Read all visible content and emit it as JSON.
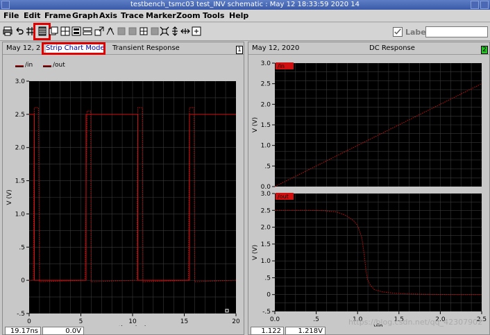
{
  "window": {
    "title": "testbench_tsmc03 test_INV schematic : May 12 18:33:59 2020 14"
  },
  "menu": [
    "File",
    "Edit",
    "Frame",
    "Graph",
    "Axis",
    "Trace",
    "Marker",
    "Zoom",
    "Tools",
    "Help"
  ],
  "toolbar": {
    "label_text": "Label",
    "label_value": ""
  },
  "left_panel": {
    "date": "May 12, 2",
    "mode": "Strip Chart Mode",
    "title": "Transient Response",
    "number": "1",
    "legend": [
      "/in",
      "/out"
    ],
    "status": [
      "19.17ns",
      "0.0V"
    ]
  },
  "right_panel": {
    "date": "May 12, 2020",
    "title": "DC Response",
    "number": "2",
    "status": [
      "1.122",
      "1.218V"
    ],
    "watermark": "https://blog.csdn.net/qq_42307902"
  },
  "colors": {
    "trace": "#d01010",
    "plot_bg": "#000000",
    "grid": "#3a3a3a",
    "num_box_right": "#22c322"
  },
  "chart_data": [
    {
      "type": "line",
      "name": "transient",
      "xlabel": "time (ns)",
      "ylabel": "V (V)",
      "xlim": [
        0,
        20
      ],
      "ylim": [
        -0.5,
        3.0
      ],
      "xticks": [
        "0",
        "5",
        "10",
        "15",
        "20"
      ],
      "yticks": [
        "-.5",
        "0",
        ".5",
        "1.0",
        "1.5",
        "2.0",
        "2.5",
        "3.0"
      ],
      "series": [
        {
          "name": "/in",
          "style": "solid",
          "x": [
            0,
            0.5,
            0.5,
            5.5,
            5.5,
            10.5,
            10.5,
            15.5,
            15.5,
            20
          ],
          "y": [
            2.5,
            2.5,
            0,
            0,
            2.5,
            2.5,
            0,
            0,
            2.5,
            2.5
          ]
        },
        {
          "name": "/out",
          "style": "dotted",
          "x": [
            0,
            0.4,
            0.5,
            0.9,
            1.0,
            5.4,
            5.6,
            5.95,
            6.0,
            10.4,
            10.5,
            10.95,
            11.0,
            15.4,
            15.5,
            15.95,
            16.0,
            20
          ],
          "y": [
            0,
            0,
            2.6,
            2.6,
            -0.02,
            0,
            2.55,
            2.55,
            -0.02,
            0,
            2.6,
            2.6,
            -0.02,
            0,
            2.6,
            2.6,
            -0.02,
            0
          ]
        }
      ]
    },
    {
      "type": "line",
      "name": "dc_in",
      "series_label": "/in",
      "ylabel": "V (V)",
      "xlim": [
        0,
        2.5
      ],
      "ylim": [
        0,
        3.0
      ],
      "yticks": [
        "0.0",
        ".5",
        "1.0",
        "1.5",
        "2.0",
        "2.5",
        "3.0"
      ],
      "series": [
        {
          "name": "/in",
          "x": [
            0,
            2.5
          ],
          "y": [
            0,
            2.5
          ]
        }
      ]
    },
    {
      "type": "line",
      "name": "dc_out",
      "series_label": "/out",
      "xlabel": "vin",
      "ylabel": "V (V)",
      "xlim": [
        0,
        2.5
      ],
      "ylim": [
        -0.5,
        3.0
      ],
      "xticks": [
        "0.0",
        ".5",
        "1.0",
        "1.5",
        "2.0",
        "2.5"
      ],
      "yticks": [
        "-.5",
        "0",
        ".5",
        "1.0",
        "1.5",
        "2.0",
        "2.5",
        "3.0"
      ],
      "series": [
        {
          "name": "/out",
          "x": [
            0,
            0.4,
            0.6,
            0.75,
            0.85,
            0.95,
            1.0,
            1.05,
            1.08,
            1.1,
            1.12,
            1.15,
            1.2,
            1.3,
            1.45,
            1.6,
            1.8,
            2.0,
            2.2,
            2.5
          ],
          "y": [
            2.5,
            2.5,
            2.49,
            2.45,
            2.36,
            2.2,
            2.05,
            1.7,
            1.2,
            0.75,
            0.45,
            0.3,
            0.15,
            0.08,
            0.04,
            0.02,
            0.01,
            0.005,
            0.0,
            0.0
          ]
        }
      ]
    }
  ]
}
